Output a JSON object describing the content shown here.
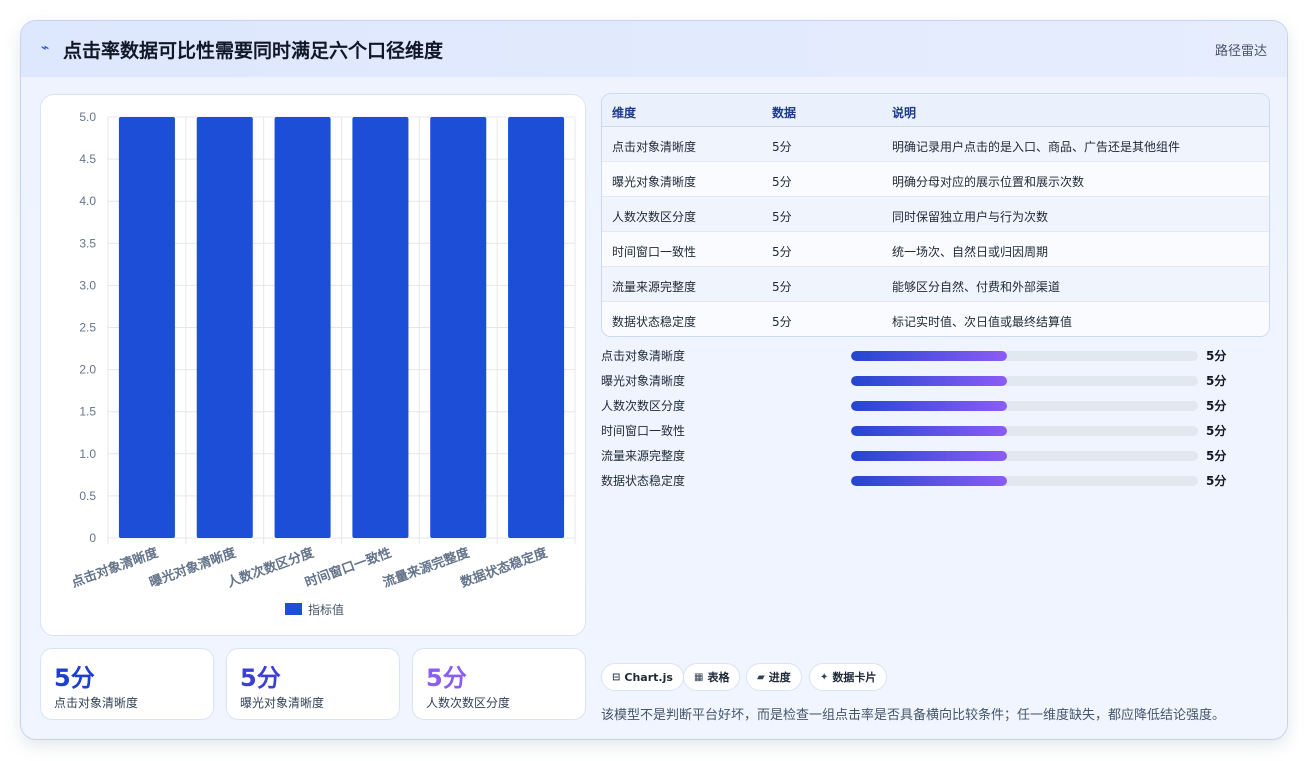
{
  "header": {
    "icon": "pulse-icon",
    "title": "点击率数据可比性需要同时满足六个口径维度",
    "tag": "路径雷达"
  },
  "chart_data": {
    "type": "bar",
    "categories": [
      "点击对象清晰度",
      "曝光对象清晰度",
      "人数次数区分度",
      "时间窗口一致性",
      "流量来源完整度",
      "数据状态稳定度"
    ],
    "series": [
      {
        "name": "指标值",
        "values": [
          5,
          5,
          5,
          5,
          5,
          5
        ]
      }
    ],
    "ylim": [
      0,
      5
    ],
    "yticks": [
      "0",
      "0.5",
      "1.0",
      "1.5",
      "2.0",
      "2.5",
      "3.0",
      "3.5",
      "4.0",
      "4.5",
      "5.0"
    ],
    "bar_color": "#1c4ed8",
    "grid": true,
    "legend": "bottom"
  },
  "stats": [
    {
      "value": "5分",
      "label": "点击对象清晰度",
      "color": "#1d3fd1"
    },
    {
      "value": "5分",
      "label": "曝光对象清晰度",
      "color": "#3b3fd6"
    },
    {
      "value": "5分",
      "label": "人数次数区分度",
      "color": "#8b5cf6"
    }
  ],
  "table": {
    "headers": [
      "维度",
      "数据",
      "说明"
    ],
    "rows": [
      [
        "点击对象清晰度",
        "5分",
        "明确记录用户点击的是入口、商品、广告还是其他组件"
      ],
      [
        "曝光对象清晰度",
        "5分",
        "明确分母对应的展示位置和展示次数"
      ],
      [
        "人数次数区分度",
        "5分",
        "同时保留独立用户与行为次数"
      ],
      [
        "时间窗口一致性",
        "5分",
        "统一场次、自然日或归因周期"
      ],
      [
        "流量来源完整度",
        "5分",
        "能够区分自然、付费和外部渠道"
      ],
      [
        "数据状态稳定度",
        "5分",
        "标记实时值、次日值或最终结算值"
      ]
    ]
  },
  "progress": [
    {
      "label": "点击对象清晰度",
      "value": "5分",
      "fraction": 0.45
    },
    {
      "label": "曝光对象清晰度",
      "value": "5分",
      "fraction": 0.45
    },
    {
      "label": "人数次数区分度",
      "value": "5分",
      "fraction": 0.45
    },
    {
      "label": "时间窗口一致性",
      "value": "5分",
      "fraction": 0.45
    },
    {
      "label": "流量来源完整度",
      "value": "5分",
      "fraction": 0.45
    },
    {
      "label": "数据状态稳定度",
      "value": "5分",
      "fraction": 0.45
    }
  ],
  "chips": [
    {
      "icon": "chart-icon",
      "glyph": "⊟",
      "label": "Chart.js"
    },
    {
      "icon": "table-icon",
      "glyph": "▦",
      "label": "表格"
    },
    {
      "icon": "progress-icon",
      "glyph": "▰",
      "label": "进度"
    },
    {
      "icon": "card-icon",
      "glyph": "✦",
      "label": "数据卡片"
    }
  ],
  "footnote": "该模型不是判断平台好坏，而是检查一组点击率是否具备横向比较条件；任一维度缺失，都应降低结论强度。"
}
